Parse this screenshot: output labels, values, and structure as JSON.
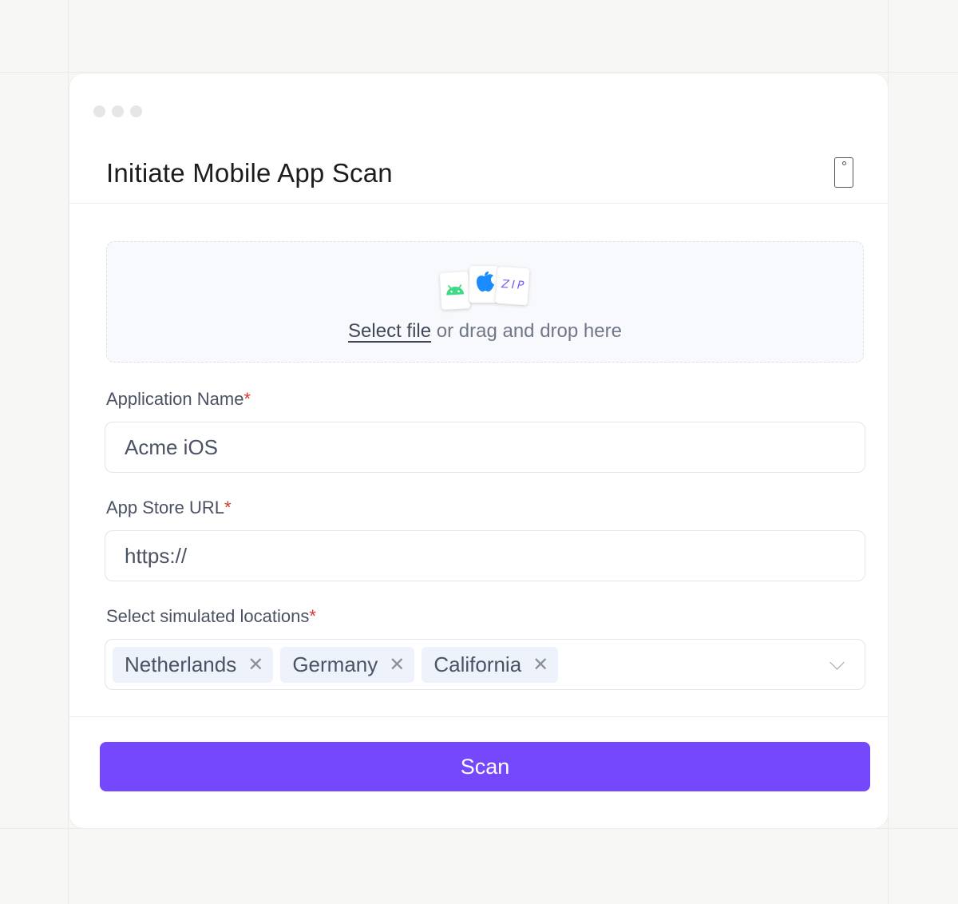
{
  "header": {
    "title": "Initiate Mobile App Scan",
    "phone_icon": "mobile-phone-icon"
  },
  "upload": {
    "link_label": "Select file",
    "hint": " or drag and drop here",
    "file_icons": [
      "android-icon",
      "apple-icon",
      "zip-icon"
    ],
    "zip_label": "ZIP"
  },
  "form": {
    "app_name": {
      "label": "Application Name",
      "value": "Acme iOS"
    },
    "store_url": {
      "label": "App Store URL",
      "value": "https://"
    },
    "locations": {
      "label": "Select simulated locations",
      "selected": [
        "Netherlands",
        "Germany",
        "California"
      ]
    },
    "required_marker": "*"
  },
  "actions": {
    "scan_label": "Scan"
  },
  "colors": {
    "accent": "#7549fb",
    "required": "#d33a2c",
    "android": "#3ddc84",
    "apple": "#1a8cff"
  }
}
